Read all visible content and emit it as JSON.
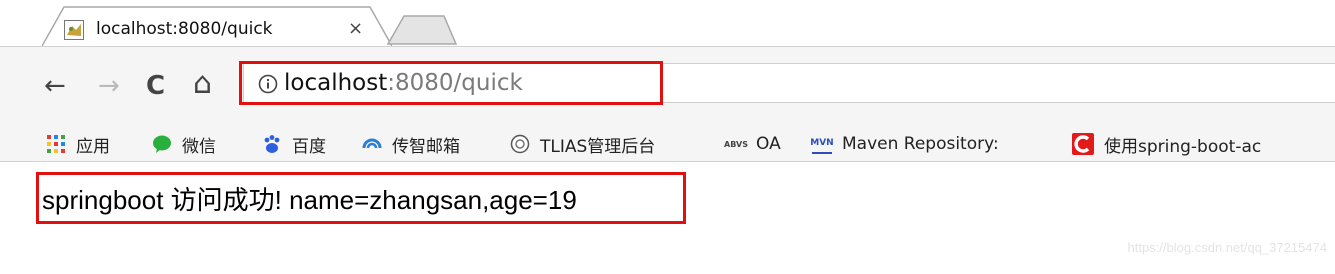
{
  "tab": {
    "title": "localhost:8080/quick",
    "close_glyph": "×",
    "favicon": "tomcat-icon"
  },
  "toolbar": {
    "back_glyph": "←",
    "forward_glyph": "→",
    "reload_glyph": "C",
    "home_glyph": "⌂",
    "url_host": "localhost",
    "url_rest": ":8080/quick",
    "highlight_color": "#e01010"
  },
  "bookmarks": [
    {
      "label": "应用",
      "icon": "apps-grid-icon"
    },
    {
      "label": "微信",
      "icon": "wechat-icon"
    },
    {
      "label": "百度",
      "icon": "baidu-icon"
    },
    {
      "label": "传智邮箱",
      "icon": "mail-cloud-icon"
    },
    {
      "label": "TLIAS管理后台",
      "icon": "circle-logo-icon"
    },
    {
      "label": "OA",
      "icon": "oa-icon"
    },
    {
      "label": "Maven Repository:",
      "icon": "mvn-icon"
    },
    {
      "label": "使用spring-boot-ac",
      "icon": "csdn-c-icon"
    }
  ],
  "content": {
    "text": "springboot 访问成功! name=zhangsan,age=19"
  },
  "watermark": "https://blog.csdn.net/qq_37215474"
}
